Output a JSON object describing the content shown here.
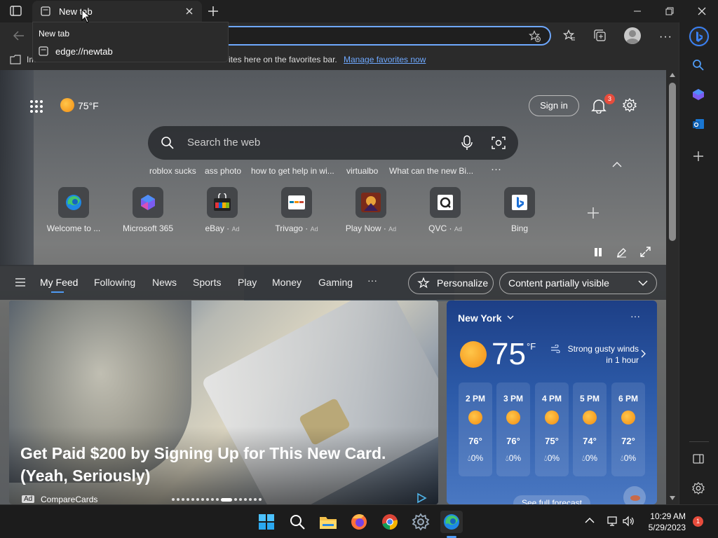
{
  "tab": {
    "title": "New tab"
  },
  "tooltip": {
    "title": "New tab",
    "url": "edge://newtab"
  },
  "favorites_bar": {
    "text_start": "Im",
    "text_end": "ites here on the favorites bar.",
    "manage_link": "Manage favorites now"
  },
  "header": {
    "weather_temp": "75°F",
    "sign_in": "Sign in",
    "notification_count": "3"
  },
  "search": {
    "placeholder": "Search the web"
  },
  "trending": [
    "roblox sucks",
    "ass photo",
    "how to get help in wi...",
    "virtualbo",
    "What can the new Bi..."
  ],
  "quick_links": [
    {
      "label": "Welcome to ...",
      "ad": ""
    },
    {
      "label": "Microsoft 365",
      "ad": ""
    },
    {
      "label": "eBay",
      "ad": "Ad"
    },
    {
      "label": "Trivago",
      "ad": "Ad"
    },
    {
      "label": "Play Now",
      "ad": "Ad"
    },
    {
      "label": "QVC",
      "ad": "Ad"
    },
    {
      "label": "Bing",
      "ad": ""
    }
  ],
  "feed_nav": {
    "items": [
      "My Feed",
      "Following",
      "News",
      "Sports",
      "Play",
      "Money",
      "Gaming"
    ],
    "active": "My Feed",
    "more": "···",
    "personalize": "Personalize",
    "content_visibility": "Content partially visible"
  },
  "hero_card": {
    "headline": "Get Paid $200 by Signing Up for This New Card. (Yeah, Seriously)",
    "ad_badge": "Ad",
    "source": "CompareCards"
  },
  "weather_card": {
    "city": "New York",
    "temp": "75",
    "unit": "°F",
    "alert": "Strong gusty winds in 1 hour",
    "more": "···",
    "hourly": [
      {
        "time": "2 PM",
        "temp": "76°",
        "precip": "0%"
      },
      {
        "time": "3 PM",
        "temp": "76°",
        "precip": "0%"
      },
      {
        "time": "4 PM",
        "temp": "75°",
        "precip": "0%"
      },
      {
        "time": "5 PM",
        "temp": "74°",
        "precip": "0%"
      },
      {
        "time": "6 PM",
        "temp": "72°",
        "precip": "0%"
      }
    ],
    "forecast_link": "See full forecast"
  },
  "taskbar": {
    "time": "10:29 AM",
    "date": "5/29/2023",
    "notification_count": "1"
  },
  "colors": {
    "accent": "#4f9bf4",
    "link": "#6ea8fe",
    "sun": "#f7a11a",
    "notify_badge": "#e74c3c"
  }
}
